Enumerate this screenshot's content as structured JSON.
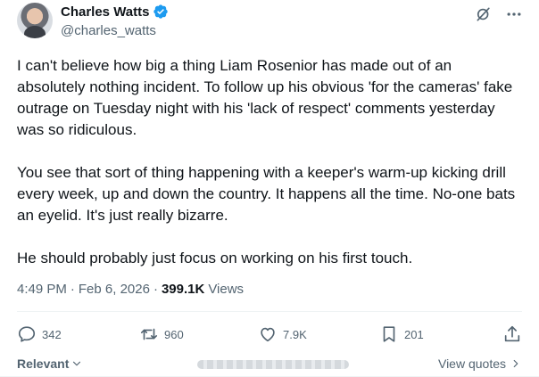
{
  "author": {
    "display_name": "Charles Watts",
    "handle": "@charles_watts",
    "verified": true
  },
  "tweet": {
    "paragraphs": [
      "I can't believe how big a thing Liam Rosenior has made out of an absolutely nothing incident. To follow up his obvious 'for the cameras' fake outrage on Tuesday night with his 'lack of respect' comments yesterday was so ridiculous.",
      "You see that sort of thing happening with a keeper's warm-up kicking drill every week, up and down the country. It happens all the time. No-one bats an eyelid. It's just really bizarre.",
      "He should probably just focus on working on his first touch."
    ],
    "time": "4:49 PM",
    "date": "Feb 6, 2026",
    "separator": "·",
    "views_count": "399.1K",
    "views_label": "Views"
  },
  "actions": {
    "replies": "342",
    "reposts": "960",
    "likes": "7.9K",
    "bookmarks": "201"
  },
  "footer": {
    "sort_label": "Relevant",
    "view_quotes_label": "View quotes"
  },
  "colors": {
    "text": "#0f1419",
    "secondary": "#536471",
    "verified": "#1d9bf0",
    "divider": "#eff3f4"
  }
}
